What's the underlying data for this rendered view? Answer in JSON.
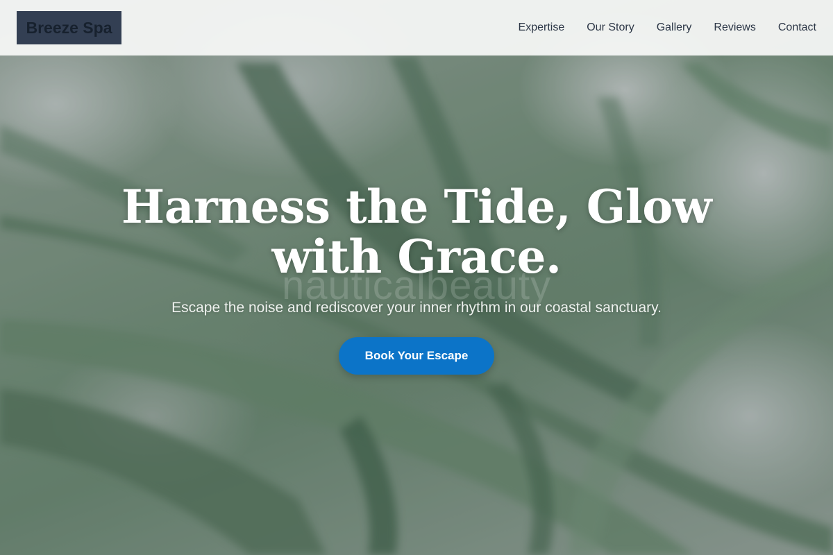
{
  "header": {
    "logo_text": "Breeze Spa",
    "nav": [
      {
        "label": "Expertise"
      },
      {
        "label": "Our Story"
      },
      {
        "label": "Gallery"
      },
      {
        "label": "Reviews"
      },
      {
        "label": "Contact"
      }
    ]
  },
  "hero": {
    "title_line1": "Harness the Tide, Glow",
    "title_line2": "with Grace.",
    "watermark": "nauticalbeauty",
    "subtitle": "Escape the noise and rediscover your inner rhythm in our coastal sanctuary.",
    "cta_label": "Book Your Escape"
  },
  "colors": {
    "accent": "#0c74c8",
    "logo_bg": "#333f53",
    "header_bg": "#f8f9f8"
  }
}
